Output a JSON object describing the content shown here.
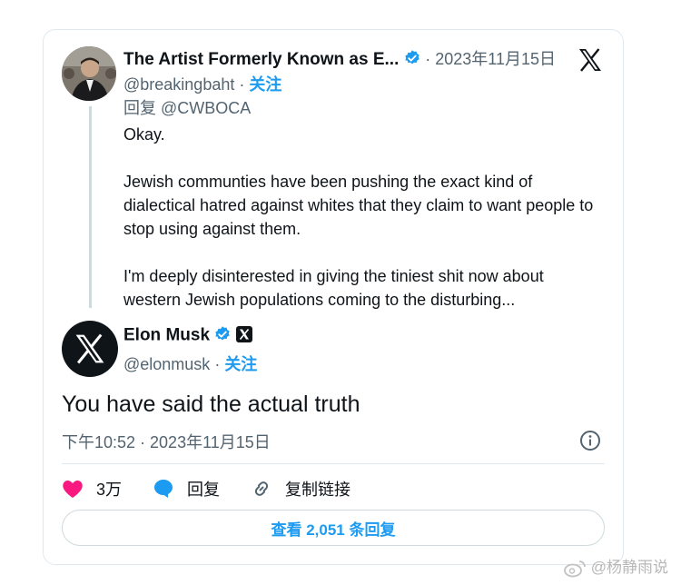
{
  "parent": {
    "name": "The Artist Formerly Known as E...",
    "date": "· 2023年11月15日",
    "handle": "@breakingbaht",
    "dot": " · ",
    "follow": "关注",
    "reply_to": "回复 @CWBOCA",
    "paragraphs": [
      "Okay.",
      "Jewish communties have been pushing the exact kind of dialectical hatred against whites that they claim to want people to stop using against them.",
      "I'm deeply disinterested in giving the tiniest shit now about western Jewish populations coming to the disturbing..."
    ]
  },
  "main": {
    "name": "Elon Musk",
    "handle": "@elonmusk",
    "dot": " · ",
    "follow": "关注",
    "text": "You have said the actual truth",
    "time": "下午10:52 · 2023年11月15日"
  },
  "actions": {
    "likes": "3万",
    "reply": "回复",
    "copy_link": "复制链接"
  },
  "replies_button": "查看 2,051 条回复",
  "watermark": "@杨静雨说",
  "colors": {
    "accent": "#1d9bf0",
    "like": "#f91880",
    "text": "#0f1419",
    "muted": "#536471"
  },
  "icons": [
    "verified-badge-icon",
    "x-logo-icon",
    "info-icon",
    "heart-icon",
    "reply-bubble-icon",
    "link-icon",
    "weibo-icon"
  ]
}
